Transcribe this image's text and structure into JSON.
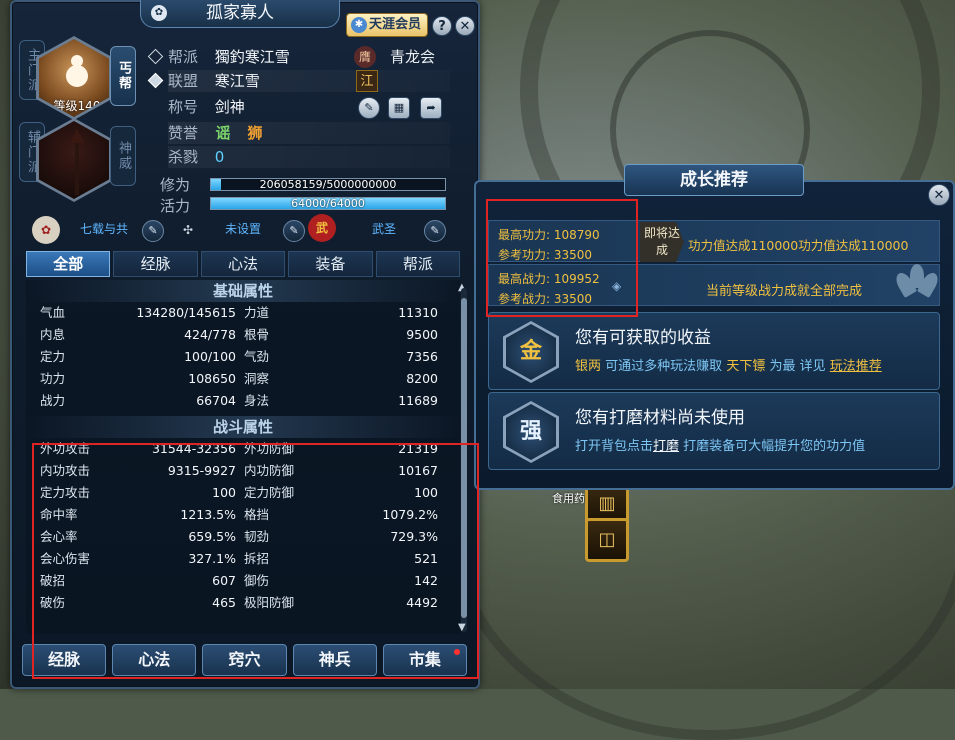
{
  "character": {
    "name": "孤家寡人",
    "vip_label": "天涯会员",
    "level_text": "等级140",
    "main_school_tag": "主门派",
    "sub_school_tag": "辅门派",
    "main_school": "丐帮",
    "sub_school": "神威",
    "guild_label": "帮派",
    "guild_value": "獨釣寒江雪",
    "guild_emblem_text": "青龙会",
    "alliance_label": "联盟",
    "alliance_value": "寒江雪",
    "alliance_emblem": "江",
    "title_label": "称号",
    "title_value": "剑神",
    "praise_label": "赞誉",
    "kill_label": "杀戮",
    "kill_value": "0",
    "cultivation_label": "修为",
    "cultivation_text": "206058159/5000000000",
    "cultivation_fraction": 0.041,
    "vitality_label": "活力",
    "vitality_text": "64000/64000",
    "vitality_fraction": 1.0,
    "title_slots": [
      "七载与共",
      "未设置",
      "武圣"
    ]
  },
  "tabs": [
    "全部",
    "经脉",
    "心法",
    "装备",
    "帮派"
  ],
  "basic_section": "基础属性",
  "basic_stats": [
    [
      "气血",
      "134280/145615",
      "力道",
      "11310"
    ],
    [
      "内息",
      "424/778",
      "根骨",
      "9500"
    ],
    [
      "定力",
      "100/100",
      "气劲",
      "7356"
    ],
    [
      "功力",
      "108650",
      "洞察",
      "8200"
    ],
    [
      "战力",
      "66704",
      "身法",
      "11689"
    ]
  ],
  "combat_section": "战斗属性",
  "combat_stats": [
    [
      "外功攻击",
      "31544-32356",
      "外功防御",
      "21319"
    ],
    [
      "内功攻击",
      "9315-9927",
      "内功防御",
      "10167"
    ],
    [
      "定力攻击",
      "100",
      "定力防御",
      "100"
    ],
    [
      "命中率",
      "1213.5%",
      "格挡",
      "1079.2%"
    ],
    [
      "会心率",
      "659.5%",
      "韧劲",
      "729.3%"
    ],
    [
      "会心伤害",
      "327.1%",
      "拆招",
      "521"
    ],
    [
      "破招",
      "607",
      "御伤",
      "142"
    ],
    [
      "破伤",
      "465",
      "极阳防御",
      "4492"
    ]
  ],
  "bottom_buttons": [
    "经脉",
    "心法",
    "窍穴",
    "神兵",
    "市集"
  ],
  "growth": {
    "title": "成长推荐",
    "max_power_label": "最高功力:",
    "max_power": "108790",
    "ref_power_label": "参考功力:",
    "ref_power": "33500",
    "upcoming_tag": "即将达成",
    "power_goal": "功力值达成110000功力值达成110000",
    "max_combat_label": "最高战力:",
    "max_combat": "109952",
    "ref_combat_label": "参考战力:",
    "ref_combat": "33500",
    "combat_done": "当前等级战力成就全部完成",
    "card1_icon": "金",
    "card1_title": "您有可获取的收益",
    "card1_desc_a": "银两",
    "card1_desc_b": "可通过多种玩法赚取",
    "card1_desc_c": "天下镖",
    "card1_desc_d": "为最 详见",
    "card1_desc_link": "玩法推荐",
    "card2_icon": "强",
    "card2_title": "您有打磨材料尚未使用",
    "card2_desc_a": "打开背包点击",
    "card2_desc_link": "打磨",
    "card2_desc_b": "打磨装备可大幅提升您的功力值"
  },
  "world": {
    "food_label": "食用药"
  }
}
